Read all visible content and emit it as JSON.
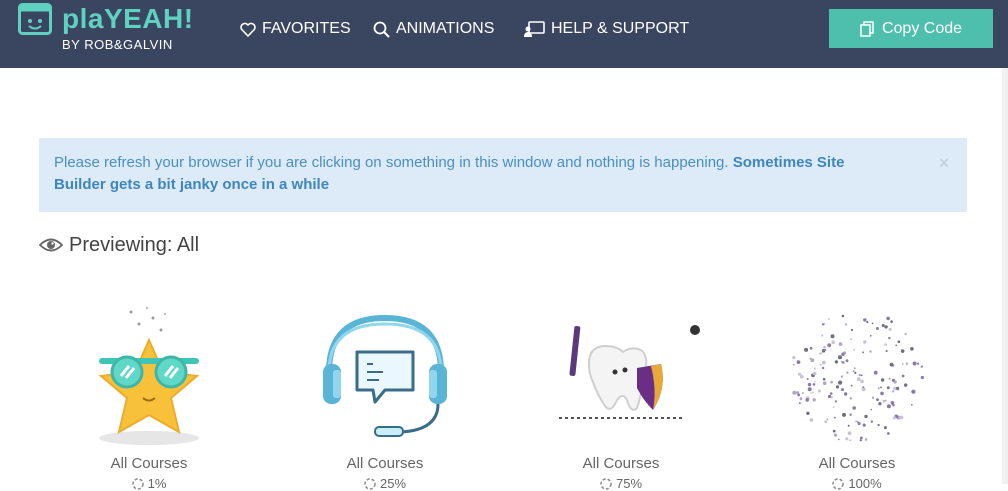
{
  "header": {
    "logo_title": "plaYEAH!",
    "logo_subtitle": "BY ROB&GALVIN",
    "nav": [
      {
        "label": "FAVORITES",
        "icon": "heart-icon"
      },
      {
        "label": "ANIMATIONS",
        "icon": "search-icon"
      },
      {
        "label": "HELP & SUPPORT",
        "icon": "support-icon"
      }
    ],
    "copy_button": "Copy Code"
  },
  "alert": {
    "text": "Please refresh your browser if you are clicking on something in this window and nothing is happening.",
    "bold": "Sometimes Site Builder gets a bit janky once in a while",
    "close": "×"
  },
  "preview": {
    "label": "Previewing: All"
  },
  "cards": [
    {
      "label": "All Courses",
      "percent": "1%",
      "art": "sunglasses-star-icon"
    },
    {
      "label": "All Courses",
      "percent": "25%",
      "art": "headset-chat-icon"
    },
    {
      "label": "All Courses",
      "percent": "75%",
      "art": "tooth-shield-icon"
    },
    {
      "label": "All Courses",
      "percent": "100%",
      "art": "confetti-burst-icon"
    }
  ],
  "colors": {
    "header_bg": "#3a4660",
    "accent": "#4fbfad",
    "alert_bg": "#dcebf7",
    "alert_text": "#4a8fc2"
  }
}
